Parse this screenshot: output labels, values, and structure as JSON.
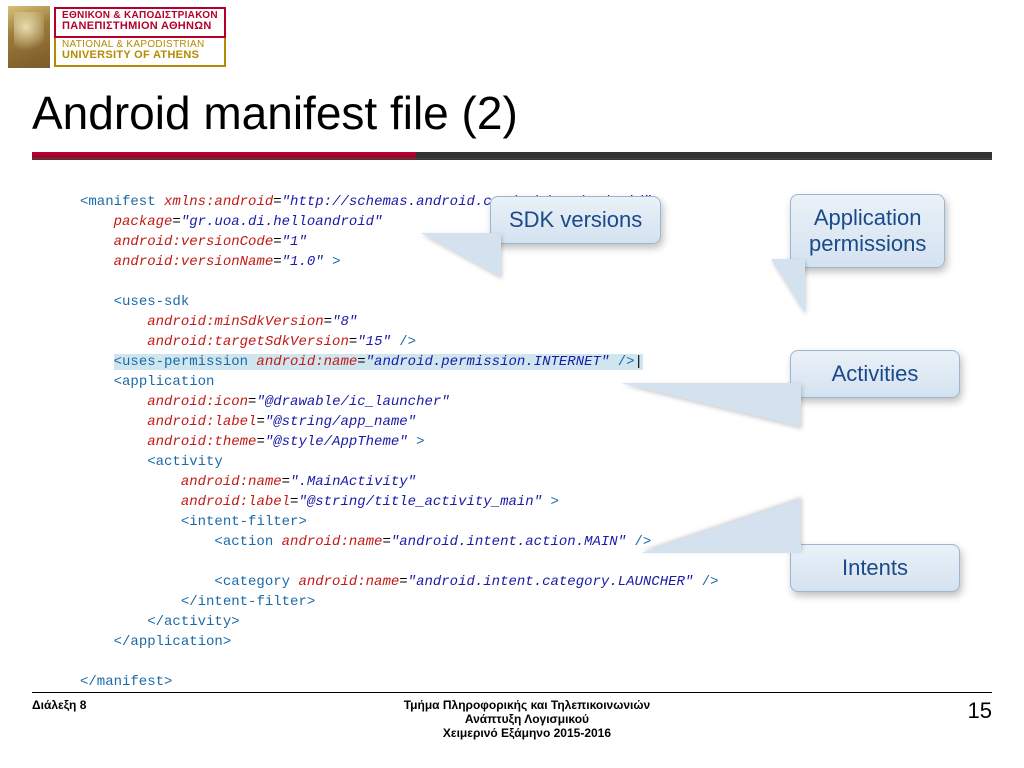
{
  "logo": {
    "gr_line1": "ΕΘΝΙΚΟΝ & ΚΑΠΟΔΙΣΤΡΙΑΚΟΝ",
    "gr_line2": "ΠΑΝΕΠΙΣΤΗΜΙΟΝ ΑΘΗΝΩΝ",
    "en_line1": "NATIONAL & KAPODISTRIAN",
    "en_line2": "UNIVERSITY OF ATHENS"
  },
  "title": "Android manifest file (2)",
  "callouts": {
    "sdk": "SDK versions",
    "permissions_l1": "Application",
    "permissions_l2": "permissions",
    "activities": "Activities",
    "intents": "Intents"
  },
  "code": {
    "l01_tag": "<manifest",
    "l01_attr": " xmlns:android",
    "l01_val": "\"http://schemas.android.com/apk/res/android\"",
    "l02_attr": "package",
    "l02_val": "\"gr.uoa.di.helloandroid\"",
    "l03_attr": "android:versionCode",
    "l03_val": "\"1\"",
    "l04_attr": "android:versionName",
    "l04_val": "\"1.0\"",
    "l04_end": " >",
    "l06_tag": "<uses-sdk",
    "l07_attr": "android:minSdkVersion",
    "l07_val": "\"8\"",
    "l08_attr": "android:targetSdkVersion",
    "l08_val": "\"15\"",
    "l08_end": " />",
    "l09_tag": "<uses-permission",
    "l09_attr": " android:name",
    "l09_val": "\"android.permission.INTERNET\"",
    "l09_end": " />",
    "l10_tag": "<application",
    "l11_attr": "android:icon",
    "l11_val": "\"@drawable/ic_launcher\"",
    "l12_attr": "android:label",
    "l12_val": "\"@string/app_name\"",
    "l13_attr": "android:theme",
    "l13_val": "\"@style/AppTheme\"",
    "l13_end": " >",
    "l14_tag": "<activity",
    "l15_attr": "android:name",
    "l15_val": "\".MainActivity\"",
    "l16_attr": "android:label",
    "l16_val": "\"@string/title_activity_main\"",
    "l16_end": " >",
    "l17_tag": "<intent-filter>",
    "l18_tag": "<action",
    "l18_attr": " android:name",
    "l18_val": "\"android.intent.action.MAIN\"",
    "l18_end": " />",
    "l20_tag": "<category",
    "l20_attr": " android:name",
    "l20_val": "\"android.intent.category.LAUNCHER\"",
    "l20_end": " />",
    "l21_tag": "</intent-filter>",
    "l22_tag": "</activity>",
    "l23_tag": "</application>",
    "l25_tag": "</manifest>"
  },
  "footer": {
    "left": "Διάλεξη 8",
    "center_l1": "Τμήμα Πληροφορικής και Τηλεπικοινωνιών",
    "center_l2": "Ανάπτυξη Λογισμικού",
    "center_l3": "Χειμερινό Εξάμηνο 2015-2016",
    "page": "15"
  }
}
